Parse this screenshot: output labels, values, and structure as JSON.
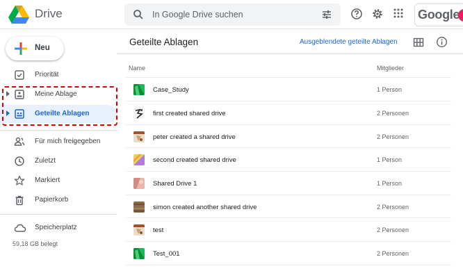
{
  "header": {
    "app_title": "Drive",
    "search_placeholder": "In Google Drive suchen",
    "account_brand": "Google"
  },
  "sidebar": {
    "new_label": "Neu",
    "items": [
      {
        "label": "Priorität",
        "icon": "priority-check-icon"
      },
      {
        "label": "Meine Ablage",
        "icon": "my-drive-icon"
      },
      {
        "label": "Geteilte Ablagen",
        "icon": "shared-drives-icon",
        "active": true
      },
      {
        "label": "Für mich freigegeben",
        "icon": "people-icon"
      },
      {
        "label": "Zuletzt",
        "icon": "clock-icon"
      },
      {
        "label": "Markiert",
        "icon": "star-icon"
      },
      {
        "label": "Papierkorb",
        "icon": "trash-icon"
      }
    ],
    "storage_label": "Speicherplatz",
    "storage_used": "59,18 GB belegt"
  },
  "main": {
    "title": "Geteilte Ablagen",
    "hidden_link": "Ausgeblendete geteilte Ablagen",
    "columns": {
      "name": "Name",
      "members": "Mitglieder"
    },
    "rows": [
      {
        "name": "Case_Study",
        "members": "1 Person",
        "icon": "green-theme-icon"
      },
      {
        "name": "first created shared drive",
        "members": "2 Personen",
        "icon": "drawing-theme-icon"
      },
      {
        "name": "peter created a shared drive",
        "members": "2 Personen",
        "icon": "craft-theme-icon"
      },
      {
        "name": "second created shared drive",
        "members": "1 Person",
        "icon": "colorful-theme-icon"
      },
      {
        "name": "Shared Drive 1",
        "members": "1 Person",
        "icon": "pink-theme-icon"
      },
      {
        "name": "simon created another shared drive",
        "members": "2 Personen",
        "icon": "wood-theme-icon"
      },
      {
        "name": "test",
        "members": "2 Personen",
        "icon": "craft-theme-icon"
      },
      {
        "name": "Test_001",
        "members": "2 Personen",
        "icon": "green-theme-icon"
      }
    ]
  },
  "colors": {
    "accent": "#1967d2",
    "active_bg": "#e8f0fe",
    "highlight_border": "#d50000"
  }
}
